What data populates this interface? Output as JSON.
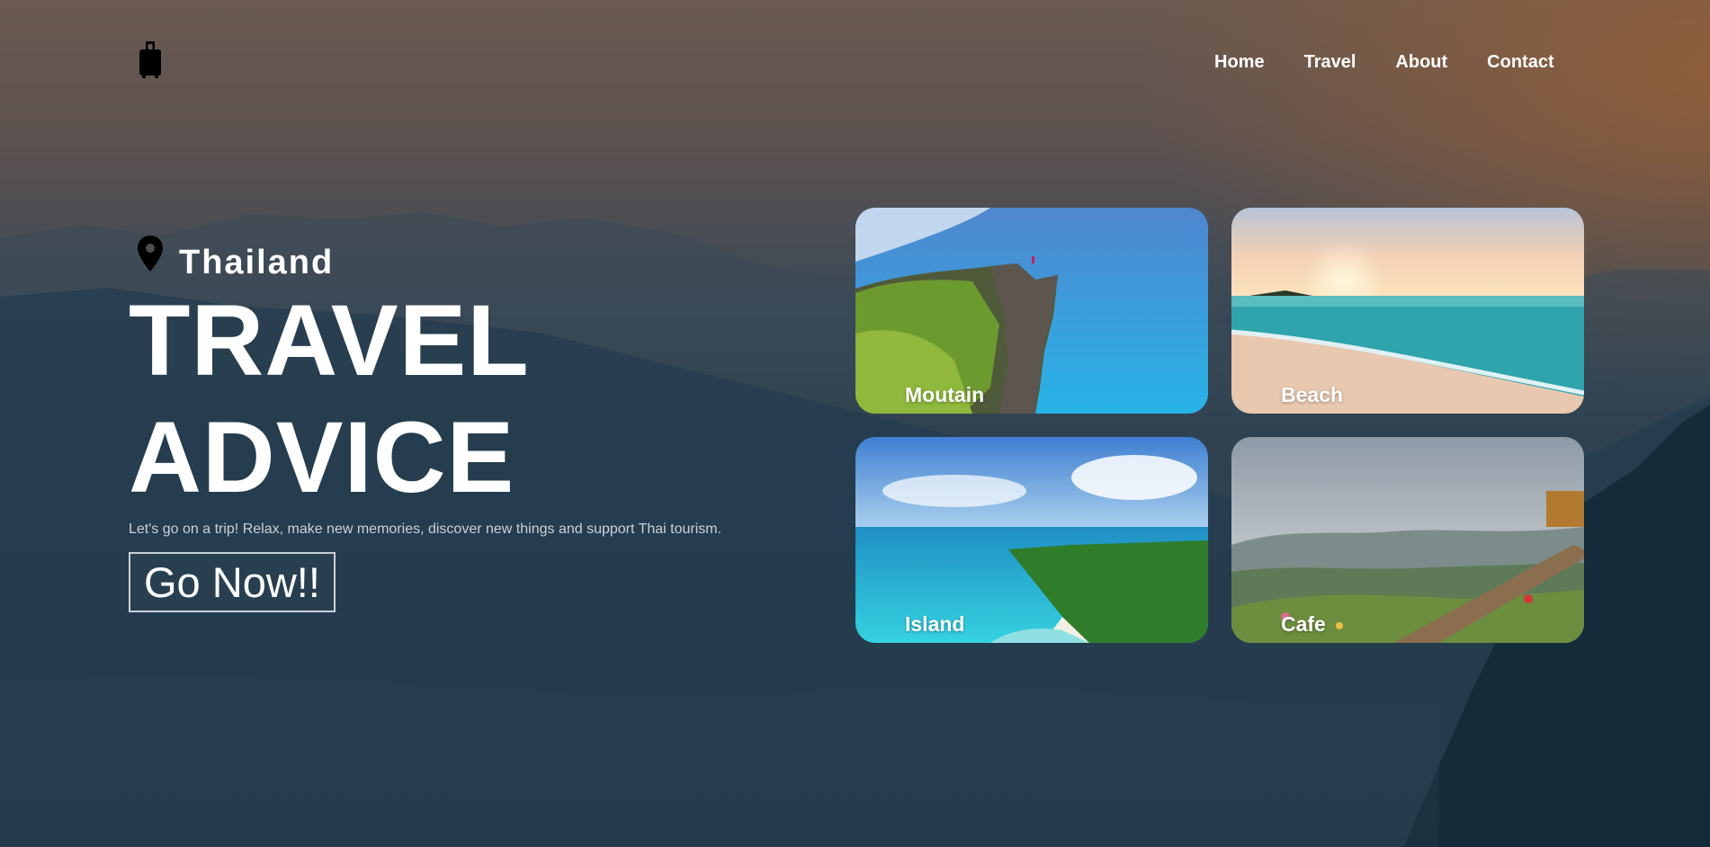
{
  "nav": {
    "logo_icon": "suitcase-icon",
    "items": [
      {
        "label": "Home"
      },
      {
        "label": "Travel"
      },
      {
        "label": "About"
      },
      {
        "label": "Contact"
      }
    ]
  },
  "hero": {
    "location_icon": "location-pin-icon",
    "location": "Thailand",
    "title_line1": "TRAVEL",
    "title_line2": "ADVICE",
    "subtitle": "Let's go on a trip! Relax, make new memories, discover new things and support Thai tourism.",
    "button_label": "Go Now!!"
  },
  "cards": [
    {
      "label": "Moutain"
    },
    {
      "label": "Beach"
    },
    {
      "label": "Island"
    },
    {
      "label": "Cafe"
    }
  ]
}
